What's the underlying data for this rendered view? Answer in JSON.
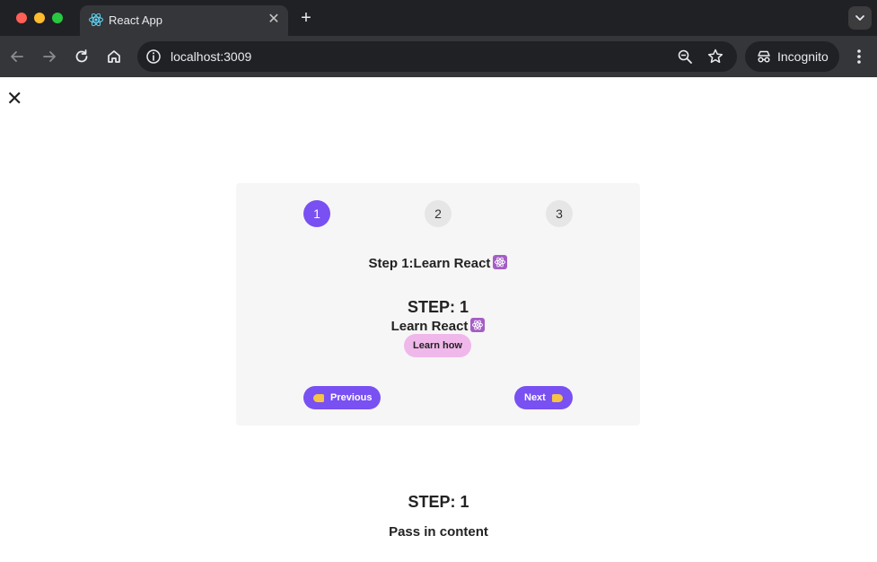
{
  "browser": {
    "tab_title": "React App",
    "url": "localhost:3009",
    "incognito_label": "Incognito"
  },
  "page": {
    "close_symbol": "✕",
    "steps": [
      "1",
      "2",
      "3"
    ],
    "active_step": 1,
    "step_heading": "Step 1:Learn React",
    "message": {
      "step_label": "STEP: 1",
      "text": "Learn React",
      "learn_button": "Learn how"
    },
    "previous_button": "Previous",
    "next_button": "Next",
    "bottom": {
      "step_label": "STEP: 1",
      "content": "Pass in content"
    }
  },
  "colors": {
    "accent": "#7950f2",
    "learn_button_bg": "#f0b8ea",
    "card_bg": "#f6f6f6",
    "inactive_step_bg": "#e6e6e6"
  },
  "icons": {
    "emoji": "atom-symbol-icon",
    "previous_icon": "backhand-index-pointing-left-icon",
    "next_icon": "backhand-index-pointing-right-icon"
  }
}
